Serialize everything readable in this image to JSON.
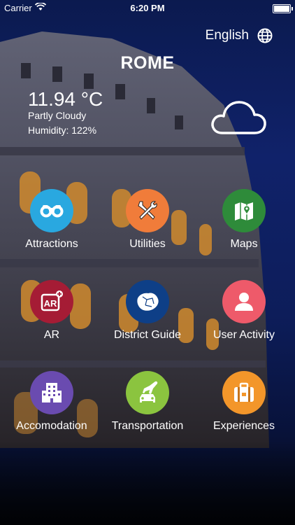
{
  "status_bar": {
    "carrier": "Carrier",
    "time": "6:20 PM",
    "battery_level": 1.0
  },
  "header": {
    "language": "English",
    "city": "ROME"
  },
  "weather": {
    "temperature": "11.94 °C",
    "condition": "Partly Cloudy",
    "humidity": "Humidity: 122%",
    "icon": "cloud-icon"
  },
  "menu": [
    {
      "label": "Attractions",
      "icon": "binoculars-icon",
      "color": "#29a8e0"
    },
    {
      "label": "Utilities",
      "icon": "tools-icon",
      "color": "#f07c3a"
    },
    {
      "label": "Maps",
      "icon": "map-icon",
      "color": "#2e8b3a"
    },
    {
      "label": "AR",
      "icon": "ar-icon",
      "color": "#a51c35"
    },
    {
      "label": "District Guide",
      "icon": "district-map-icon",
      "color": "#0e3f87"
    },
    {
      "label": "User Activity",
      "icon": "user-icon",
      "color": "#ee5a6a"
    },
    {
      "label": "Accomodation",
      "icon": "building-icon",
      "color": "#6a4bb0"
    },
    {
      "label": "Transportation",
      "icon": "car-plane-icon",
      "color": "#8bc43f"
    },
    {
      "label": "Experiences",
      "icon": "suitcase-icon",
      "color": "#f3962a"
    }
  ]
}
